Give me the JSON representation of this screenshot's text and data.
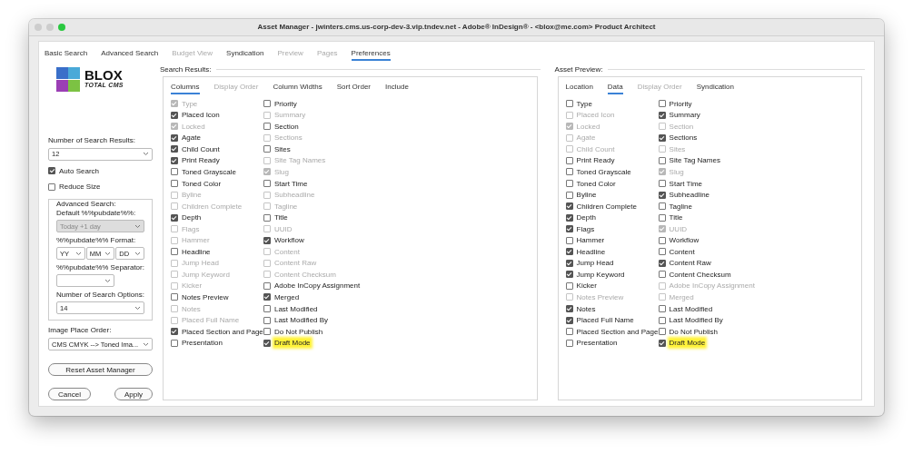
{
  "window": {
    "title": "Asset Manager - jwinters.cms.us-corp-dev-3.vip.tndev.net - Adobe® InDesign® - <blox@me.com> Product Architect"
  },
  "tabs": [
    {
      "label": "Basic Search",
      "selected": false,
      "disabled": false
    },
    {
      "label": "Advanced Search",
      "selected": false,
      "disabled": false
    },
    {
      "label": "Budget View",
      "selected": false,
      "disabled": true
    },
    {
      "label": "Syndication",
      "selected": false,
      "disabled": false
    },
    {
      "label": "Preview",
      "selected": false,
      "disabled": true
    },
    {
      "label": "Pages",
      "selected": false,
      "disabled": true
    },
    {
      "label": "Preferences",
      "selected": true,
      "disabled": false
    }
  ],
  "sidebar": {
    "logo": {
      "name": "BLOX",
      "tagline": "TOTAL CMS"
    },
    "search_results_label": "Number of Search Results:",
    "search_results_value": "12",
    "checkboxes": [
      {
        "label": "Auto Search",
        "checked": true
      },
      {
        "label": "Reduce Size",
        "checked": false
      }
    ],
    "advanced": {
      "title": "Advanced Search:",
      "default_label": "Default %%pubdate%%:",
      "default_value": "Today +1 day",
      "default_disabled": true,
      "format_label": "%%pubdate%% Format:",
      "format_values": [
        "YY",
        "MM",
        "DD"
      ],
      "separator_label": "%%pubdate%% Separator:",
      "options_label": "Number of Search Options:",
      "options_value": "14"
    },
    "image_order_label": "Image Place Order:",
    "image_order_value": "CMS CMYK --> Toned Ima...",
    "reset_button": "Reset Asset Manager",
    "buttons": [
      "Cancel",
      "Apply"
    ]
  },
  "panels": [
    {
      "title": "Search Results:",
      "tabs": [
        {
          "label": "Columns",
          "selected": true,
          "disabled": false
        },
        {
          "label": "Display Order",
          "selected": false,
          "disabled": true
        },
        {
          "label": "Column Widths",
          "selected": false,
          "disabled": false
        },
        {
          "label": "Sort Order",
          "selected": false,
          "disabled": false
        },
        {
          "label": "Include",
          "selected": false,
          "disabled": false
        }
      ],
      "columns": [
        [
          {
            "label": "Type",
            "checked": true,
            "disabled": true,
            "highlighted": false
          },
          {
            "label": "Placed Icon",
            "checked": true,
            "disabled": false,
            "highlighted": false
          },
          {
            "label": "Locked",
            "checked": true,
            "disabled": true,
            "highlighted": false
          },
          {
            "label": "Agate",
            "checked": true,
            "disabled": false,
            "highlighted": false
          },
          {
            "label": "Child Count",
            "checked": true,
            "disabled": false,
            "highlighted": false
          },
          {
            "label": "Print Ready",
            "checked": true,
            "disabled": false,
            "highlighted": false
          },
          {
            "label": "Toned Grayscale",
            "checked": false,
            "disabled": false,
            "highlighted": false
          },
          {
            "label": "Toned Color",
            "checked": false,
            "disabled": false,
            "highlighted": false
          },
          {
            "label": "Byline",
            "checked": false,
            "disabled": true,
            "highlighted": false
          },
          {
            "label": "Children Complete",
            "checked": false,
            "disabled": true,
            "highlighted": false
          },
          {
            "label": "Depth",
            "checked": true,
            "disabled": false,
            "highlighted": false
          },
          {
            "label": "Flags",
            "checked": false,
            "disabled": true,
            "highlighted": false
          },
          {
            "label": "Hammer",
            "checked": false,
            "disabled": true,
            "highlighted": false
          },
          {
            "label": "Headline",
            "checked": false,
            "disabled": false,
            "highlighted": false
          },
          {
            "label": "Jump Head",
            "checked": false,
            "disabled": true,
            "highlighted": false
          },
          {
            "label": "Jump Keyword",
            "checked": false,
            "disabled": true,
            "highlighted": false
          },
          {
            "label": "Kicker",
            "checked": false,
            "disabled": true,
            "highlighted": false
          },
          {
            "label": "Notes Preview",
            "checked": false,
            "disabled": false,
            "highlighted": false
          },
          {
            "label": "Notes",
            "checked": false,
            "disabled": true,
            "highlighted": false
          },
          {
            "label": "Placed Full Name",
            "checked": false,
            "disabled": true,
            "highlighted": false
          },
          {
            "label": "Placed Section and Page",
            "checked": true,
            "disabled": false,
            "highlighted": false
          },
          {
            "label": "Presentation",
            "checked": false,
            "disabled": false,
            "highlighted": false
          }
        ],
        [
          {
            "label": "Priority",
            "checked": false,
            "disabled": false,
            "highlighted": false
          },
          {
            "label": "Summary",
            "checked": false,
            "disabled": true,
            "highlighted": false
          },
          {
            "label": "Section",
            "checked": false,
            "disabled": false,
            "highlighted": false
          },
          {
            "label": "Sections",
            "checked": false,
            "disabled": true,
            "highlighted": false
          },
          {
            "label": "Sites",
            "checked": false,
            "disabled": false,
            "highlighted": false
          },
          {
            "label": "Site Tag Names",
            "checked": false,
            "disabled": true,
            "highlighted": false
          },
          {
            "label": "Slug",
            "checked": true,
            "disabled": true,
            "highlighted": false
          },
          {
            "label": "Start Time",
            "checked": false,
            "disabled": false,
            "highlighted": false
          },
          {
            "label": "Subheadline",
            "checked": false,
            "disabled": true,
            "highlighted": false
          },
          {
            "label": "Tagline",
            "checked": false,
            "disabled": true,
            "highlighted": false
          },
          {
            "label": "Title",
            "checked": false,
            "disabled": false,
            "highlighted": false
          },
          {
            "label": "UUID",
            "checked": false,
            "disabled": true,
            "highlighted": false
          },
          {
            "label": "Workflow",
            "checked": true,
            "disabled": false,
            "highlighted": false
          },
          {
            "label": "Content",
            "checked": false,
            "disabled": true,
            "highlighted": false
          },
          {
            "label": "Content Raw",
            "checked": false,
            "disabled": true,
            "highlighted": false
          },
          {
            "label": "Content Checksum",
            "checked": false,
            "disabled": true,
            "highlighted": false
          },
          {
            "label": "Adobe InCopy Assignment",
            "checked": false,
            "disabled": false,
            "highlighted": false
          },
          {
            "label": "Merged",
            "checked": true,
            "disabled": false,
            "highlighted": false
          },
          {
            "label": "Last Modified",
            "checked": false,
            "disabled": false,
            "highlighted": false
          },
          {
            "label": "Last Modified By",
            "checked": false,
            "disabled": false,
            "highlighted": false
          },
          {
            "label": "Do Not Publish",
            "checked": false,
            "disabled": false,
            "highlighted": false
          },
          {
            "label": "Draft Mode",
            "checked": true,
            "disabled": false,
            "highlighted": true
          }
        ]
      ]
    },
    {
      "title": "Asset Preview:",
      "tabs": [
        {
          "label": "Location",
          "selected": false,
          "disabled": false
        },
        {
          "label": "Data",
          "selected": true,
          "disabled": false
        },
        {
          "label": "Display Order",
          "selected": false,
          "disabled": true
        },
        {
          "label": "Syndication",
          "selected": false,
          "disabled": false
        }
      ],
      "columns": [
        [
          {
            "label": "Type",
            "checked": false,
            "disabled": false,
            "highlighted": false
          },
          {
            "label": "Placed Icon",
            "checked": false,
            "disabled": true,
            "highlighted": false
          },
          {
            "label": "Locked",
            "checked": true,
            "disabled": true,
            "highlighted": false
          },
          {
            "label": "Agate",
            "checked": false,
            "disabled": true,
            "highlighted": false
          },
          {
            "label": "Child Count",
            "checked": false,
            "disabled": true,
            "highlighted": false
          },
          {
            "label": "Print Ready",
            "checked": false,
            "disabled": false,
            "highlighted": false
          },
          {
            "label": "Toned Grayscale",
            "checked": false,
            "disabled": false,
            "highlighted": false
          },
          {
            "label": "Toned Color",
            "checked": false,
            "disabled": false,
            "highlighted": false
          },
          {
            "label": "Byline",
            "checked": false,
            "disabled": false,
            "highlighted": false
          },
          {
            "label": "Children Complete",
            "checked": true,
            "disabled": false,
            "highlighted": false
          },
          {
            "label": "Depth",
            "checked": true,
            "disabled": false,
            "highlighted": false
          },
          {
            "label": "Flags",
            "checked": true,
            "disabled": false,
            "highlighted": false
          },
          {
            "label": "Hammer",
            "checked": false,
            "disabled": false,
            "highlighted": false
          },
          {
            "label": "Headline",
            "checked": true,
            "disabled": false,
            "highlighted": false
          },
          {
            "label": "Jump Head",
            "checked": true,
            "disabled": false,
            "highlighted": false
          },
          {
            "label": "Jump Keyword",
            "checked": true,
            "disabled": false,
            "highlighted": false
          },
          {
            "label": "Kicker",
            "checked": false,
            "disabled": false,
            "highlighted": false
          },
          {
            "label": "Notes Preview",
            "checked": false,
            "disabled": true,
            "highlighted": false
          },
          {
            "label": "Notes",
            "checked": true,
            "disabled": false,
            "highlighted": false
          },
          {
            "label": "Placed Full Name",
            "checked": true,
            "disabled": false,
            "highlighted": false
          },
          {
            "label": "Placed Section and Page",
            "checked": false,
            "disabled": false,
            "highlighted": false
          },
          {
            "label": "Presentation",
            "checked": false,
            "disabled": false,
            "highlighted": false
          }
        ],
        [
          {
            "label": "Priority",
            "checked": false,
            "disabled": false,
            "highlighted": false
          },
          {
            "label": "Summary",
            "checked": true,
            "disabled": false,
            "highlighted": false
          },
          {
            "label": "Section",
            "checked": false,
            "disabled": true,
            "highlighted": false
          },
          {
            "label": "Sections",
            "checked": true,
            "disabled": false,
            "highlighted": false
          },
          {
            "label": "Sites",
            "checked": false,
            "disabled": true,
            "highlighted": false
          },
          {
            "label": "Site Tag Names",
            "checked": false,
            "disabled": false,
            "highlighted": false
          },
          {
            "label": "Slug",
            "checked": true,
            "disabled": true,
            "highlighted": false
          },
          {
            "label": "Start Time",
            "checked": false,
            "disabled": false,
            "highlighted": false
          },
          {
            "label": "Subheadline",
            "checked": true,
            "disabled": false,
            "highlighted": false
          },
          {
            "label": "Tagline",
            "checked": false,
            "disabled": false,
            "highlighted": false
          },
          {
            "label": "Title",
            "checked": false,
            "disabled": false,
            "highlighted": false
          },
          {
            "label": "UUID",
            "checked": true,
            "disabled": true,
            "highlighted": false
          },
          {
            "label": "Workflow",
            "checked": false,
            "disabled": false,
            "highlighted": false
          },
          {
            "label": "Content",
            "checked": false,
            "disabled": false,
            "highlighted": false
          },
          {
            "label": "Content Raw",
            "checked": true,
            "disabled": false,
            "highlighted": false
          },
          {
            "label": "Content Checksum",
            "checked": false,
            "disabled": false,
            "highlighted": false
          },
          {
            "label": "Adobe InCopy Assignment",
            "checked": false,
            "disabled": true,
            "highlighted": false
          },
          {
            "label": "Merged",
            "checked": false,
            "disabled": true,
            "highlighted": false
          },
          {
            "label": "Last Modified",
            "checked": false,
            "disabled": false,
            "highlighted": false
          },
          {
            "label": "Last Modified By",
            "checked": false,
            "disabled": false,
            "highlighted": false
          },
          {
            "label": "Do Not Publish",
            "checked": false,
            "disabled": false,
            "highlighted": false
          },
          {
            "label": "Draft Mode",
            "checked": true,
            "disabled": false,
            "highlighted": true
          }
        ]
      ]
    }
  ]
}
